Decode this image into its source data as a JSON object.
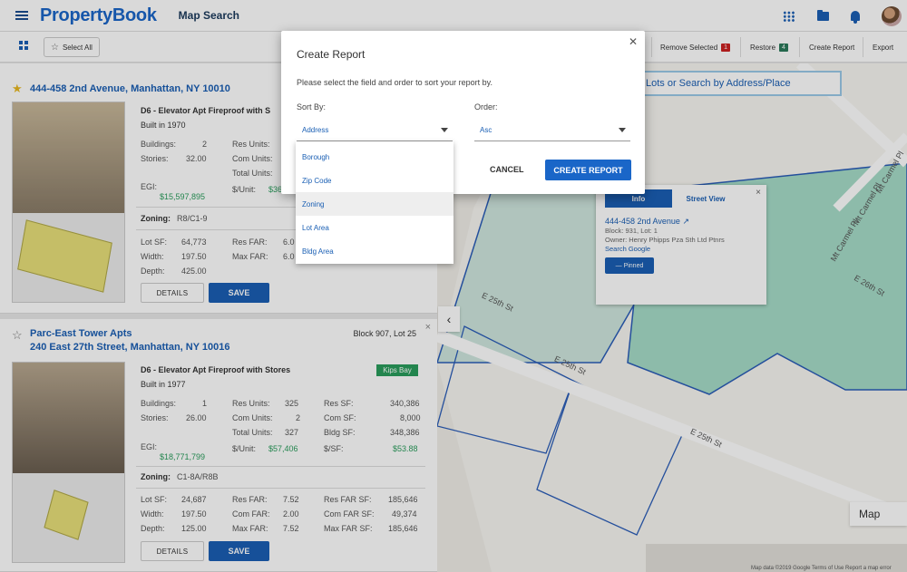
{
  "app": {
    "logo": "PropertyBook",
    "page_title": "Map Search"
  },
  "header_icons": [
    "grid-apps-icon",
    "folder-icon",
    "bell-icon",
    "avatar"
  ],
  "toolbar": {
    "select_all": "Select All",
    "remove_selected": "Remove Selected",
    "remove_count": "1",
    "restore": "Restore",
    "restore_count": "4",
    "create_report": "Create Report",
    "export": "Export"
  },
  "colors": {
    "primary": "#1a5fb4",
    "remove_badge": "#cc2222",
    "restore_badge": "#2a7a5a",
    "neighborhood_badge": "#2a9d5c"
  },
  "map": {
    "search_text": "Lots or Search by Address/Place",
    "streets": [
      "E 25th St",
      "E 25th St",
      "E 25th St",
      "E 26th St",
      "E 26th St",
      "Mt Carmel Pl",
      "Mt Carmel Pl",
      "Mt Carmel Pl"
    ],
    "map_type": "Map",
    "copyright": "Map data ©2019 Google   Terms of Use   Report a map error",
    "infocard": {
      "tab_info": "Info",
      "tab_street": "Street View",
      "address": "444-458 2nd Avenue",
      "block_lot": "Block: 931, Lot: 1",
      "owner": "Owner: Henry Phipps Pza Sth Ltd Ptnrs",
      "search_link": "Search Google",
      "pinned": "— Pinned"
    }
  },
  "cards": [
    {
      "address": "444-458 2nd Avenue, Manhattan, NY 10010",
      "starred": true,
      "type": "D6 - Elevator Apt Fireproof with S",
      "built": "Built in 1970",
      "buildings_l": "Buildings:",
      "buildings": "2",
      "stories_l": "Stories:",
      "stories": "32.00",
      "res_units_l": "Res Units:",
      "com_units_l": "Com Units:",
      "total_units_l": "Total Units:",
      "egi_l": "EGI:",
      "egi": "$15,597,895",
      "per_unit_l": "$/Unit:",
      "per_unit": "$36",
      "zoning_l": "Zoning:",
      "zoning": "R8/C1-9",
      "lot_sf_l": "Lot SF:",
      "lot_sf": "64,773",
      "width_l": "Width:",
      "width": "197.50",
      "depth_l": "Depth:",
      "depth": "425.00",
      "res_far_l": "Res FAR:",
      "res_far": "6.0",
      "max_far_l": "Max FAR:",
      "max_far": "6.0",
      "details": "DETAILS",
      "save": "SAVE"
    },
    {
      "name": "Parc-East Tower Apts",
      "address": "240 East 27th Street, Manhattan, NY 10016",
      "starred": false,
      "block": "Block 907, Lot 25",
      "type": "D6 - Elevator Apt Fireproof with Stores",
      "neighborhood": "Kips Bay",
      "built": "Built in 1977",
      "buildings_l": "Buildings:",
      "buildings": "1",
      "stories_l": "Stories:",
      "stories": "26.00",
      "res_units_l": "Res Units:",
      "res_units": "325",
      "com_units_l": "Com Units:",
      "com_units": "2",
      "total_units_l": "Total Units:",
      "total_units": "327",
      "res_sf_l": "Res SF:",
      "res_sf": "340,386",
      "com_sf_l": "Com SF:",
      "com_sf": "8,000",
      "bldg_sf_l": "Bldg SF:",
      "bldg_sf": "348,386",
      "egi_l": "EGI:",
      "egi": "$18,771,799",
      "per_unit_l": "$/Unit:",
      "per_unit": "$57,406",
      "per_sf_l": "$/SF:",
      "per_sf": "$53.88",
      "zoning_l": "Zoning:",
      "zoning": "C1-8A/R8B",
      "lot_sf_l": "Lot SF:",
      "lot_sf": "24,687",
      "width_l": "Width:",
      "width": "197.50",
      "depth_l": "Depth:",
      "depth": "125.00",
      "res_far_l": "Res FAR:",
      "res_far": "7.52",
      "com_far_l": "Com FAR:",
      "com_far": "2.00",
      "max_far_l": "Max FAR:",
      "max_far": "7.52",
      "res_far_sf_l": "Res FAR SF:",
      "res_far_sf": "185,646",
      "com_far_sf_l": "Com FAR SF:",
      "com_far_sf": "49,374",
      "max_far_sf_l": "Max FAR SF:",
      "max_far_sf": "185,646",
      "details": "DETAILS",
      "save": "SAVE"
    }
  ],
  "modal": {
    "title": "Create Report",
    "prompt": "Please select the field and order to sort your report by.",
    "sort_by_label": "Sort By:",
    "sort_by_value": "Address",
    "order_label": "Order:",
    "order_value": "Asc",
    "cancel": "CANCEL",
    "create": "CREATE REPORT",
    "options": [
      "Borough",
      "Zip Code",
      "Zoning",
      "Lot Area",
      "Bldg Area"
    ],
    "highlighted_option": "Zoning"
  }
}
